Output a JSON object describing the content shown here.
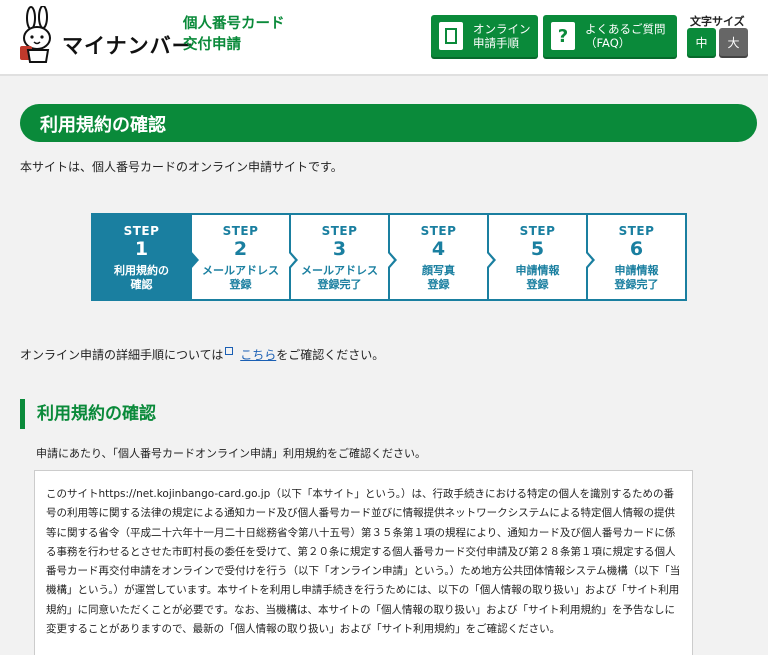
{
  "header": {
    "logo_text": "マイナンバー",
    "brand_line1": "個人番号カード",
    "brand_line2": "交付申請",
    "online_line1": "オンライン",
    "online_line2": "申請手順",
    "faq_line1": "よくあるご質問",
    "faq_line2": "（FAQ）",
    "font_size_label": "文字サイズ",
    "font_mid": "中",
    "font_large": "大"
  },
  "page": {
    "title": "利用規約の確認",
    "intro": "本サイトは、個人番号カードのオンライン申請サイトです。"
  },
  "steps": [
    {
      "word": "STEP",
      "num": "1",
      "line1": "利用規約の",
      "line2": "確認",
      "active": true
    },
    {
      "word": "STEP",
      "num": "2",
      "line1": "メールアドレス",
      "line2": "登録",
      "active": false
    },
    {
      "word": "STEP",
      "num": "3",
      "line1": "メールアドレス",
      "line2": "登録完了",
      "active": false
    },
    {
      "word": "STEP",
      "num": "4",
      "line1": "顔写真",
      "line2": "登録",
      "active": false
    },
    {
      "word": "STEP",
      "num": "5",
      "line1": "申請情報",
      "line2": "登録",
      "active": false
    },
    {
      "word": "STEP",
      "num": "6",
      "line1": "申請情報",
      "line2": "登録完了",
      "active": false
    }
  ],
  "detail": {
    "before": "オンライン申請の詳細手順については",
    "link": "こちら",
    "after": "をご確認ください。"
  },
  "section": {
    "heading": "利用規約の確認",
    "sub": "申請にあたり、「個人番号カードオンライン申請」利用規約をご確認ください。",
    "terms": "このサイトhttps://net.kojinbango-card.go.jp（以下「本サイト」という。）は、行政手続きにおける特定の個人を識別するための番号の利用等に関する法律の規定による通知カード及び個人番号カード並びに情報提供ネットワークシステムによる特定個人情報の提供等に関する省令（平成二十六年十一月二十日総務省令第八十五号）第３５条第１項の規程により、通知カード及び個人番号カードに係る事務を行わせるとさせた市町村長の委任を受けて、第２０条に規定する個人番号カード交付申請及び第２８条第１項に規定する個人番号カード再交付申請をオンラインで受付けを行う（以下「オンライン申請」という。）ため地方公共団体情報システム機構（以下「当機構」という。）が運営しています。本サイトを利用し申請手続きを行うためには、以下の「個人情報の取り扱い」および「サイト利用規約」に同意いただくことが必要です。なお、当機構は、本サイトの「個人情報の取り扱い」および「サイト利用規約」を予告なしに変更することがありますので、最新の「個人情報の取り扱い」および「サイト利用規約」をご確認ください。"
  },
  "colors": {
    "brand_green": "#0a8a3a",
    "step_blue": "#1a7fa0",
    "link_blue": "#1a5fb4"
  }
}
